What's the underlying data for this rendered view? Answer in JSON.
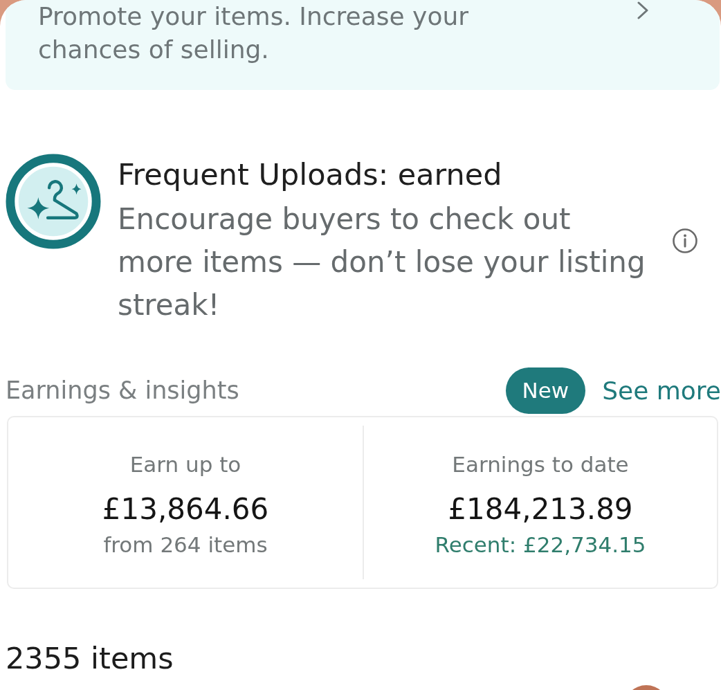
{
  "promo_banner": {
    "text": "Promote your items. Increase your chances of selling."
  },
  "badge": {
    "title": "Frequent Uploads: earned",
    "description": "Encourage buyers to check out more items — don’t lose your listing streak!"
  },
  "earnings": {
    "title": "Earnings & insights",
    "tag": "New",
    "link": "See more",
    "stats": [
      {
        "kind": "plain",
        "label": "Earn up to",
        "value": "£13,864.66",
        "note": "from 264 items"
      },
      {
        "kind": "highlight",
        "label": "Earnings to date",
        "value": "£184,213.89",
        "note": "Recent: £22,734.15"
      }
    ]
  },
  "items_count": "2355 items"
}
